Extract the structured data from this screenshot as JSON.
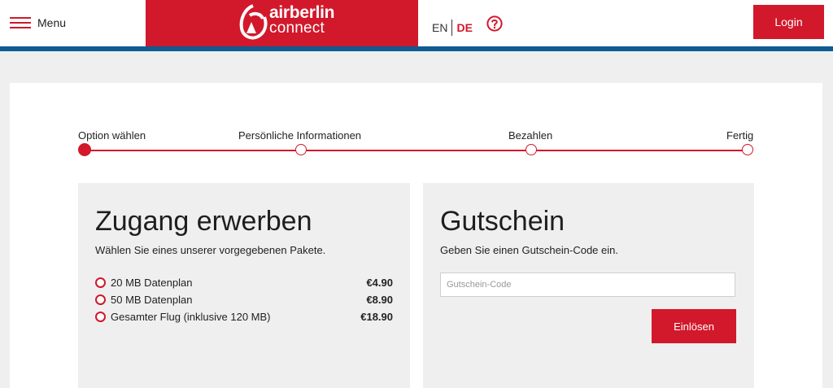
{
  "header": {
    "menu_label": "Menu",
    "logo": {
      "line1": "airberlin",
      "line2": "connect"
    },
    "languages": {
      "en": "EN",
      "de": "DE",
      "active": "DE"
    },
    "login_label": "Login"
  },
  "steps": [
    {
      "label": "Option wählen",
      "active": true
    },
    {
      "label": "Persönliche Informationen",
      "active": false
    },
    {
      "label": "Bezahlen",
      "active": false
    },
    {
      "label": "Fertig",
      "active": false
    }
  ],
  "purchase": {
    "title": "Zugang erwerben",
    "subtitle": "Wählen Sie eines unserer vorgegebenen Pakete.",
    "packages": [
      {
        "name": "20 MB Datenplan",
        "price": "€4.90"
      },
      {
        "name": "50 MB Datenplan",
        "price": "€8.90"
      },
      {
        "name": "Gesamter Flug (inklusive 120 MB)",
        "price": "€18.90"
      }
    ]
  },
  "voucher": {
    "title": "Gutschein",
    "subtitle": "Geben Sie einen Gutschein-Code ein.",
    "input_placeholder": "Gutschein-Code",
    "input_value": "",
    "redeem_label": "Einlösen"
  },
  "colors": {
    "brand_red": "#d2182b",
    "header_stripe": "#0f5b93",
    "page_bg": "#efefef"
  }
}
